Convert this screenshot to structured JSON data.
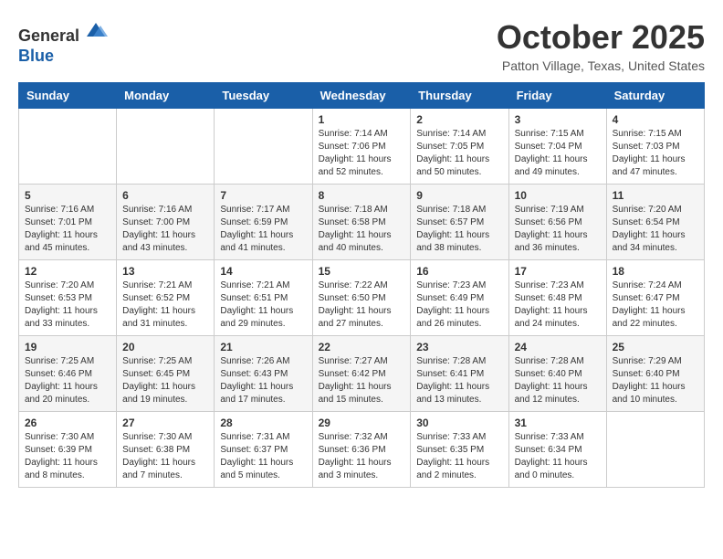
{
  "header": {
    "logo_line1": "General",
    "logo_line2": "Blue",
    "month": "October 2025",
    "location": "Patton Village, Texas, United States"
  },
  "weekdays": [
    "Sunday",
    "Monday",
    "Tuesday",
    "Wednesday",
    "Thursday",
    "Friday",
    "Saturday"
  ],
  "weeks": [
    [
      {
        "day": "",
        "info": ""
      },
      {
        "day": "",
        "info": ""
      },
      {
        "day": "",
        "info": ""
      },
      {
        "day": "1",
        "info": "Sunrise: 7:14 AM\nSunset: 7:06 PM\nDaylight: 11 hours\nand 52 minutes."
      },
      {
        "day": "2",
        "info": "Sunrise: 7:14 AM\nSunset: 7:05 PM\nDaylight: 11 hours\nand 50 minutes."
      },
      {
        "day": "3",
        "info": "Sunrise: 7:15 AM\nSunset: 7:04 PM\nDaylight: 11 hours\nand 49 minutes."
      },
      {
        "day": "4",
        "info": "Sunrise: 7:15 AM\nSunset: 7:03 PM\nDaylight: 11 hours\nand 47 minutes."
      }
    ],
    [
      {
        "day": "5",
        "info": "Sunrise: 7:16 AM\nSunset: 7:01 PM\nDaylight: 11 hours\nand 45 minutes."
      },
      {
        "day": "6",
        "info": "Sunrise: 7:16 AM\nSunset: 7:00 PM\nDaylight: 11 hours\nand 43 minutes."
      },
      {
        "day": "7",
        "info": "Sunrise: 7:17 AM\nSunset: 6:59 PM\nDaylight: 11 hours\nand 41 minutes."
      },
      {
        "day": "8",
        "info": "Sunrise: 7:18 AM\nSunset: 6:58 PM\nDaylight: 11 hours\nand 40 minutes."
      },
      {
        "day": "9",
        "info": "Sunrise: 7:18 AM\nSunset: 6:57 PM\nDaylight: 11 hours\nand 38 minutes."
      },
      {
        "day": "10",
        "info": "Sunrise: 7:19 AM\nSunset: 6:56 PM\nDaylight: 11 hours\nand 36 minutes."
      },
      {
        "day": "11",
        "info": "Sunrise: 7:20 AM\nSunset: 6:54 PM\nDaylight: 11 hours\nand 34 minutes."
      }
    ],
    [
      {
        "day": "12",
        "info": "Sunrise: 7:20 AM\nSunset: 6:53 PM\nDaylight: 11 hours\nand 33 minutes."
      },
      {
        "day": "13",
        "info": "Sunrise: 7:21 AM\nSunset: 6:52 PM\nDaylight: 11 hours\nand 31 minutes."
      },
      {
        "day": "14",
        "info": "Sunrise: 7:21 AM\nSunset: 6:51 PM\nDaylight: 11 hours\nand 29 minutes."
      },
      {
        "day": "15",
        "info": "Sunrise: 7:22 AM\nSunset: 6:50 PM\nDaylight: 11 hours\nand 27 minutes."
      },
      {
        "day": "16",
        "info": "Sunrise: 7:23 AM\nSunset: 6:49 PM\nDaylight: 11 hours\nand 26 minutes."
      },
      {
        "day": "17",
        "info": "Sunrise: 7:23 AM\nSunset: 6:48 PM\nDaylight: 11 hours\nand 24 minutes."
      },
      {
        "day": "18",
        "info": "Sunrise: 7:24 AM\nSunset: 6:47 PM\nDaylight: 11 hours\nand 22 minutes."
      }
    ],
    [
      {
        "day": "19",
        "info": "Sunrise: 7:25 AM\nSunset: 6:46 PM\nDaylight: 11 hours\nand 20 minutes."
      },
      {
        "day": "20",
        "info": "Sunrise: 7:25 AM\nSunset: 6:45 PM\nDaylight: 11 hours\nand 19 minutes."
      },
      {
        "day": "21",
        "info": "Sunrise: 7:26 AM\nSunset: 6:43 PM\nDaylight: 11 hours\nand 17 minutes."
      },
      {
        "day": "22",
        "info": "Sunrise: 7:27 AM\nSunset: 6:42 PM\nDaylight: 11 hours\nand 15 minutes."
      },
      {
        "day": "23",
        "info": "Sunrise: 7:28 AM\nSunset: 6:41 PM\nDaylight: 11 hours\nand 13 minutes."
      },
      {
        "day": "24",
        "info": "Sunrise: 7:28 AM\nSunset: 6:40 PM\nDaylight: 11 hours\nand 12 minutes."
      },
      {
        "day": "25",
        "info": "Sunrise: 7:29 AM\nSunset: 6:40 PM\nDaylight: 11 hours\nand 10 minutes."
      }
    ],
    [
      {
        "day": "26",
        "info": "Sunrise: 7:30 AM\nSunset: 6:39 PM\nDaylight: 11 hours\nand 8 minutes."
      },
      {
        "day": "27",
        "info": "Sunrise: 7:30 AM\nSunset: 6:38 PM\nDaylight: 11 hours\nand 7 minutes."
      },
      {
        "day": "28",
        "info": "Sunrise: 7:31 AM\nSunset: 6:37 PM\nDaylight: 11 hours\nand 5 minutes."
      },
      {
        "day": "29",
        "info": "Sunrise: 7:32 AM\nSunset: 6:36 PM\nDaylight: 11 hours\nand 3 minutes."
      },
      {
        "day": "30",
        "info": "Sunrise: 7:33 AM\nSunset: 6:35 PM\nDaylight: 11 hours\nand 2 minutes."
      },
      {
        "day": "31",
        "info": "Sunrise: 7:33 AM\nSunset: 6:34 PM\nDaylight: 11 hours\nand 0 minutes."
      },
      {
        "day": "",
        "info": ""
      }
    ]
  ]
}
